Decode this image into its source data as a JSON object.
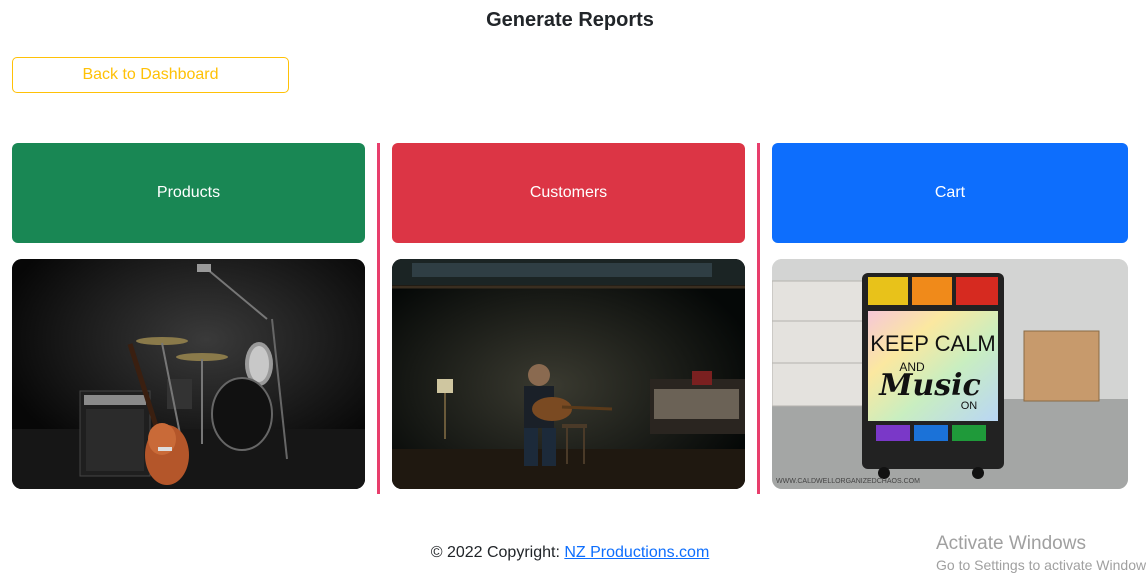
{
  "page": {
    "title": "Generate Reports"
  },
  "actions": {
    "back_label": "Back to Dashboard"
  },
  "cards": [
    {
      "label": "Products",
      "color": "#198754",
      "image": "music-studio-drums-guitar"
    },
    {
      "label": "Customers",
      "color": "#dc3545",
      "image": "man-playing-guitar-in-attic"
    },
    {
      "label": "Cart",
      "color": "#0d6efd",
      "image": "keep-calm-music-cart"
    }
  ],
  "cart_image": {
    "line1": "KEEP CALM",
    "line2": "AND",
    "line3": "Music",
    "line4": "ON",
    "caption": "WWW.CALDWELLORGANIZEDCHAOS.COM"
  },
  "footer": {
    "prefix": "© 2022 Copyright: ",
    "link_text": "NZ Productions.com"
  },
  "watermark": {
    "title": "Activate Windows",
    "subtitle": "Go to Settings to activate Windows."
  },
  "colors": {
    "accent_warning": "#ffc107",
    "success": "#198754",
    "danger": "#dc3545",
    "primary": "#0d6efd",
    "divider": "#e83e6c"
  }
}
